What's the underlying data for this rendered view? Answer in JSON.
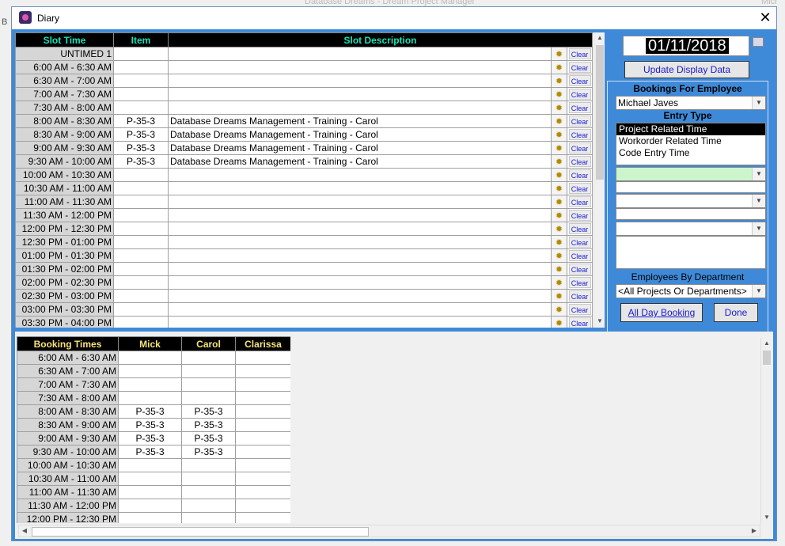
{
  "background": {
    "title": "Database Dreams - Dream Project Manager",
    "right_text": "Micr",
    "left_text": "B"
  },
  "window": {
    "title": "Diary",
    "close_glyph": "✕"
  },
  "top_grid": {
    "headers": {
      "time": "Slot Time",
      "item": "Item",
      "desc": "Slot Description"
    },
    "clear_label": "Clear",
    "rows": [
      {
        "time": "UNTIMED 1",
        "item": "",
        "desc": ""
      },
      {
        "time": "6:00 AM - 6:30 AM",
        "item": "",
        "desc": ""
      },
      {
        "time": "6:30 AM - 7:00 AM",
        "item": "",
        "desc": ""
      },
      {
        "time": "7:00 AM - 7:30 AM",
        "item": "",
        "desc": ""
      },
      {
        "time": "7:30 AM - 8:00 AM",
        "item": "",
        "desc": ""
      },
      {
        "time": "8:00 AM - 8:30 AM",
        "item": "P-35-3",
        "desc": "Database Dreams Management - Training - Carol"
      },
      {
        "time": "8:30 AM - 9:00 AM",
        "item": "P-35-3",
        "desc": "Database Dreams Management - Training - Carol"
      },
      {
        "time": "9:00 AM - 9:30 AM",
        "item": "P-35-3",
        "desc": "Database Dreams Management - Training - Carol"
      },
      {
        "time": "9:30 AM - 10:00 AM",
        "item": "P-35-3",
        "desc": "Database Dreams Management - Training - Carol"
      },
      {
        "time": "10:00 AM - 10:30 AM",
        "item": "",
        "desc": ""
      },
      {
        "time": "10:30 AM - 11:00 AM",
        "item": "",
        "desc": ""
      },
      {
        "time": "11:00 AM - 11:30 AM",
        "item": "",
        "desc": ""
      },
      {
        "time": "11:30 AM - 12:00 PM",
        "item": "",
        "desc": ""
      },
      {
        "time": "12:00 PM - 12:30 PM",
        "item": "",
        "desc": ""
      },
      {
        "time": "12:30 PM - 01:00 PM",
        "item": "",
        "desc": ""
      },
      {
        "time": "01:00 PM - 01:30 PM",
        "item": "",
        "desc": ""
      },
      {
        "time": "01:30 PM - 02:00 PM",
        "item": "",
        "desc": ""
      },
      {
        "time": "02:00 PM - 02:30 PM",
        "item": "",
        "desc": ""
      },
      {
        "time": "02:30 PM - 03:00 PM",
        "item": "",
        "desc": ""
      },
      {
        "time": "03:00 PM - 03:30 PM",
        "item": "",
        "desc": ""
      },
      {
        "time": "03:30 PM - 04:00 PM",
        "item": "",
        "desc": ""
      }
    ]
  },
  "side_panel": {
    "date": "01/11/2018",
    "update_button": "Update Display Data",
    "bookings_label": "Bookings For Employee",
    "employee": "Michael Javes",
    "entry_type_label": "Entry Type",
    "entry_types": [
      "Project Related Time",
      "Workorder Related Time",
      "Code Entry Time"
    ],
    "selected_entry_type": "Project Related Time",
    "dept_label": "Employees By Department",
    "dept_value": "<All Projects Or Departments>",
    "all_day_button": "All Day Booking",
    "done_button": "Done"
  },
  "bottom_grid": {
    "headers": [
      "Booking Times",
      "Mick",
      "Carol",
      "Clarissa"
    ],
    "rows": [
      {
        "time": "6:00 AM - 6:30 AM",
        "cells": [
          "",
          "",
          ""
        ]
      },
      {
        "time": "6:30 AM - 7:00 AM",
        "cells": [
          "",
          "",
          ""
        ]
      },
      {
        "time": "7:00 AM - 7:30 AM",
        "cells": [
          "",
          "",
          ""
        ]
      },
      {
        "time": "7:30 AM - 8:00 AM",
        "cells": [
          "",
          "",
          ""
        ]
      },
      {
        "time": "8:00 AM - 8:30 AM",
        "cells": [
          "P-35-3",
          "P-35-3",
          ""
        ]
      },
      {
        "time": "8:30 AM - 9:00 AM",
        "cells": [
          "P-35-3",
          "P-35-3",
          ""
        ]
      },
      {
        "time": "9:00 AM - 9:30 AM",
        "cells": [
          "P-35-3",
          "P-35-3",
          ""
        ]
      },
      {
        "time": "9:30 AM - 10:00 AM",
        "cells": [
          "P-35-3",
          "P-35-3",
          ""
        ]
      },
      {
        "time": "10:00 AM - 10:30 AM",
        "cells": [
          "",
          "",
          ""
        ]
      },
      {
        "time": "10:30 AM - 11:00 AM",
        "cells": [
          "",
          "",
          ""
        ]
      },
      {
        "time": "11:00 AM - 11:30 AM",
        "cells": [
          "",
          "",
          ""
        ]
      },
      {
        "time": "11:30 AM - 12:00 PM",
        "cells": [
          "",
          "",
          ""
        ]
      },
      {
        "time": "12:00 PM - 12:30 PM",
        "cells": [
          "",
          "",
          ""
        ]
      }
    ]
  }
}
